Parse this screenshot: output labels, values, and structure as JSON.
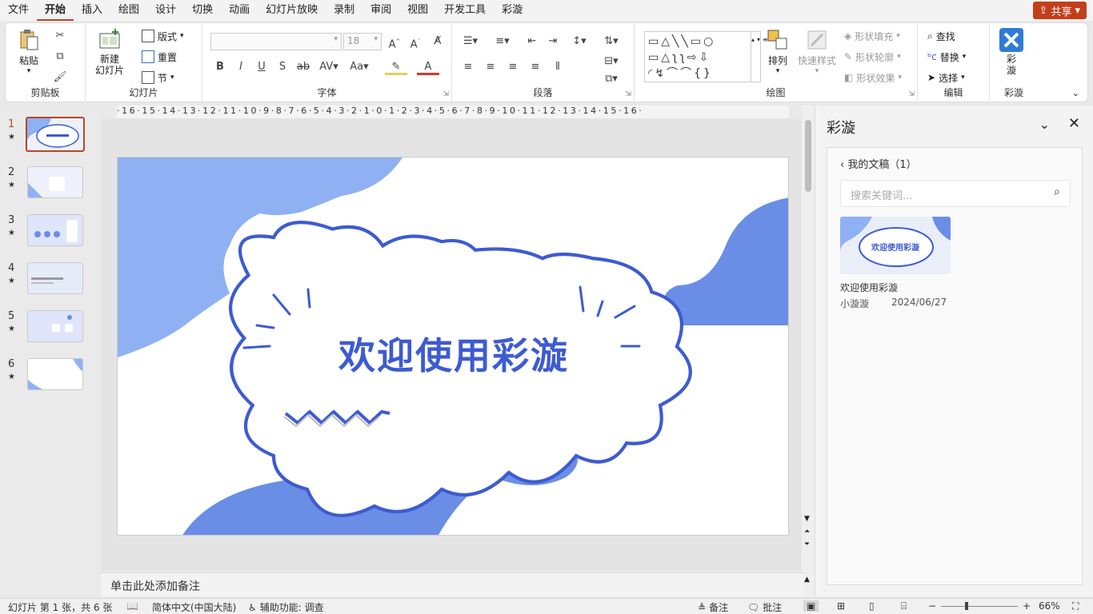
{
  "menu": {
    "tabs": [
      "文件",
      "开始",
      "插入",
      "绘图",
      "设计",
      "切换",
      "动画",
      "幻灯片放映",
      "录制",
      "审阅",
      "视图",
      "开发工具",
      "彩漩"
    ],
    "active": "开始",
    "share": "共享"
  },
  "ribbon": {
    "clipboard": {
      "label": "剪贴板",
      "paste": "粘贴"
    },
    "slides": {
      "label": "幻灯片",
      "new_slide": "新建\n幻灯片",
      "layout": "版式",
      "reset": "重置",
      "section": "节"
    },
    "font": {
      "label": "字体",
      "font_name": "",
      "font_size": "18"
    },
    "paragraph": {
      "label": "段落"
    },
    "drawing": {
      "label": "绘图",
      "arrange": "排列",
      "quick_styles": "快速样式",
      "shape_fill": "形状填充",
      "shape_outline": "形状轮廓",
      "shape_effect": "形状效果"
    },
    "editing": {
      "label": "编辑",
      "find": "查找",
      "replace": "替换",
      "select": "选择"
    },
    "caixuan": {
      "label": "彩漩",
      "button": "彩\n漩"
    }
  },
  "thumbnails": [
    {
      "num": "1",
      "star": "★"
    },
    {
      "num": "2",
      "star": "★"
    },
    {
      "num": "3",
      "star": "★"
    },
    {
      "num": "4",
      "star": "★"
    },
    {
      "num": "5",
      "star": "★"
    },
    {
      "num": "6",
      "star": "★"
    }
  ],
  "ruler": "·16·15·14·13·12·11·10·9·8·7·6·5·4·3·2·1·0·1·2·3·4·5·6·7·8·9·10·11·12·13·14·15·16·",
  "slide": {
    "title": "欢迎使用彩漩"
  },
  "notes": {
    "placeholder": "单击此处添加备注"
  },
  "pane": {
    "title": "彩漩",
    "breadcrumb": "我的文稿（1）",
    "search_placeholder": "搜索关键词...",
    "doc": {
      "thumb_text": "欢迎使用彩漩",
      "name": "欢迎使用彩漩",
      "author": "小漩漩",
      "date": "2024/06/27"
    }
  },
  "status": {
    "slide_info": "幻灯片 第 1 张，共 6 张",
    "language": "简体中文(中国大陆)",
    "accessibility": "辅助功能: 调查",
    "notes": "备注",
    "comments": "批注",
    "zoom": "66%"
  },
  "colors": {
    "accent": "#b7472a",
    "slide_blue": "#3d5bd1",
    "light_blue": "#8fb1f3",
    "mid_blue": "#6a8ee6"
  }
}
